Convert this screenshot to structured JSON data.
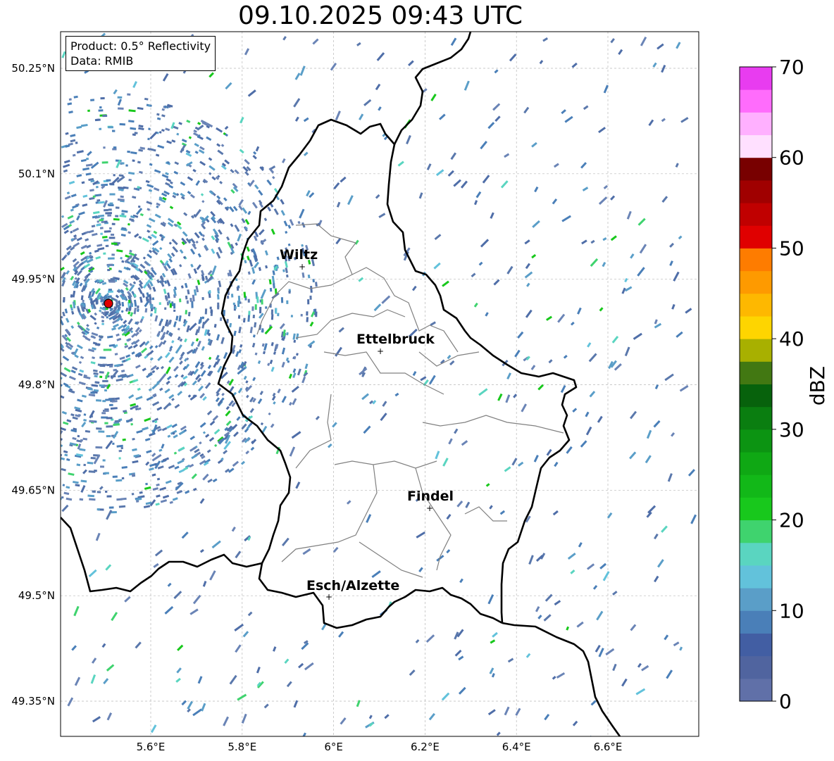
{
  "title": "09.10.2025 09:43 UTC",
  "info": {
    "product": "Product: 0.5° Reflectivity",
    "data": "Data: RMIB"
  },
  "map": {
    "lon_range": [
      5.4,
      6.8
    ],
    "lat_range": [
      49.3,
      50.3
    ],
    "lat_ticks": [
      {
        "value": 50.25,
        "label": "50.25°N"
      },
      {
        "value": 50.1,
        "label": "50.1°N"
      },
      {
        "value": 49.95,
        "label": "49.95°N"
      },
      {
        "value": 49.8,
        "label": "49.8°N"
      },
      {
        "value": 49.65,
        "label": "49.65°N"
      },
      {
        "value": 49.5,
        "label": "49.5°N"
      },
      {
        "value": 49.35,
        "label": "49.35°N"
      }
    ],
    "lon_ticks": [
      {
        "value": 5.6,
        "label": "5.6°E"
      },
      {
        "value": 5.8,
        "label": "5.8°E"
      },
      {
        "value": 6.0,
        "label": "6°E"
      },
      {
        "value": 6.2,
        "label": "6.2°E"
      },
      {
        "value": 6.4,
        "label": "6.4°E"
      },
      {
        "value": 6.6,
        "label": "6.6°E"
      }
    ],
    "radar_site": {
      "lon": 5.505,
      "lat": 49.914
    },
    "cities": [
      {
        "name": "Wiltz",
        "lon": 5.933,
        "lat": 49.967
      },
      {
        "name": "Ettelbruck",
        "lon": 6.104,
        "lat": 49.847
      },
      {
        "name": "Findel",
        "lon": 6.211,
        "lat": 49.627
      },
      {
        "name": "Esch/Alzette",
        "lon": 5.989,
        "lat": 49.499
      }
    ]
  },
  "colorbar": {
    "label": "dBZ",
    "min": 0,
    "max": 70,
    "ticks": [
      "0",
      "10",
      "20",
      "30",
      "40",
      "50",
      "60",
      "70"
    ],
    "colors": [
      "#6070a8",
      "#50649f",
      "#425ea3",
      "#4a7fb8",
      "#5a9ec8",
      "#62c2db",
      "#5ad5c0",
      "#3fd36e",
      "#18c81c",
      "#12b818",
      "#0fa814",
      "#0c9412",
      "#0a7e10",
      "#07620c",
      "#427812",
      "#a8b000",
      "#fed500",
      "#feb800",
      "#fe9a00",
      "#fe7c00",
      "#e00000",
      "#c00000",
      "#a00000",
      "#780000",
      "#ffe0ff",
      "#ffb0ff",
      "#ff6cfc",
      "#e83cf0"
    ]
  }
}
